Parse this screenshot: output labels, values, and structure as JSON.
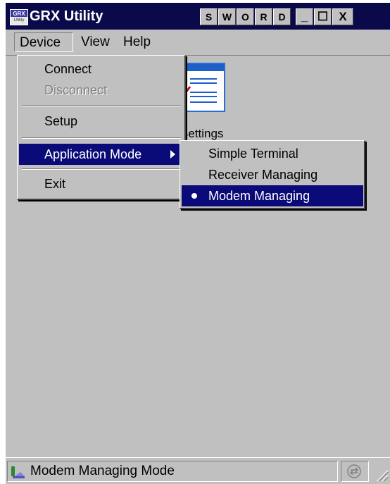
{
  "window": {
    "title": "GRX Utility",
    "app_icon_text": "GRX",
    "app_icon_subtext": "Utility",
    "title_buttons": [
      "S",
      "W",
      "O",
      "R",
      "D"
    ],
    "minimize_symbol": "_",
    "maximize_symbol": "☐",
    "close_symbol": "X"
  },
  "menubar": {
    "items": [
      {
        "label": "Device",
        "active": true
      },
      {
        "label": "View",
        "active": false
      },
      {
        "label": "Help",
        "active": false
      }
    ]
  },
  "device_menu": {
    "items": [
      {
        "label": "Connect",
        "enabled": true
      },
      {
        "label": "Disconnect",
        "enabled": false
      },
      {
        "label": "Setup",
        "enabled": true
      },
      {
        "label": "Application Mode",
        "enabled": true,
        "has_submenu": true,
        "highlighted": true
      },
      {
        "label": "Exit",
        "enabled": true
      }
    ]
  },
  "application_mode_submenu": {
    "items": [
      {
        "label": "Simple Terminal",
        "selected": false
      },
      {
        "label": "Receiver Managing",
        "selected": false
      },
      {
        "label": "Modem Managing",
        "selected": true
      }
    ]
  },
  "content": {
    "settings_label": "Settings",
    "settings_icon": "settings-checklist-icon"
  },
  "statusbar": {
    "text": "Modem Managing Mode",
    "left_icon": "modem-icon",
    "right_icon": "connection-status-icon"
  },
  "colors": {
    "title_bar": "#0a0a4a",
    "highlight": "#0a0a78",
    "face": "#c0c0c0"
  }
}
